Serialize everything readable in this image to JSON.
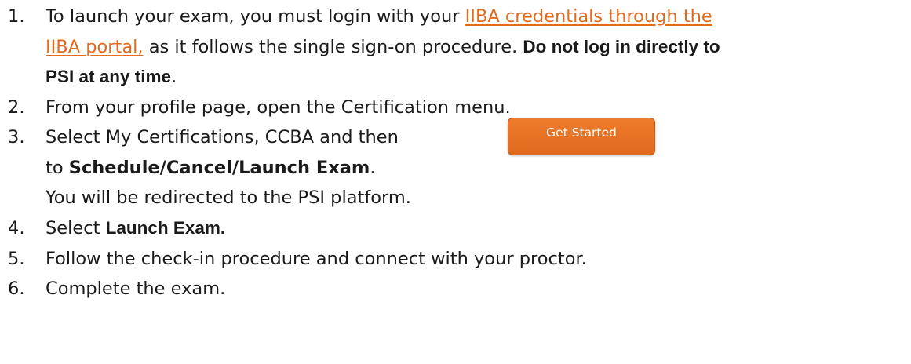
{
  "accent_color": "#e46a1c",
  "steps": [
    {
      "number": "1.",
      "lines": [
        {
          "prefix": "To launch your exam, you must login with your ",
          "link": "IIBA credentials through the"
        },
        {
          "link": "IIBA portal,",
          "text": " as it follows the single sign-on procedure.  ",
          "bold": "Do not log in directly to"
        },
        {
          "bold": "PSI at any time",
          "suffix": "."
        }
      ]
    },
    {
      "number": "2.",
      "text": "From your profile page, open the Certification menu."
    },
    {
      "number": "3.",
      "text": "Select My Certifications, CCBA and then",
      "button_label": "Get Started",
      "line2_prefix": "to ",
      "line2_bold": "Schedule/Cancel/Launch Exam",
      "line2_suffix": ".",
      "line3": "You will be redirected to the PSI platform."
    },
    {
      "number": "4.",
      "prefix": "Select ",
      "bold": "Launch Exam."
    },
    {
      "number": "5.",
      "text": "Follow the check-in procedure and connect with your proctor."
    },
    {
      "number": "6.",
      "text": "Complete the exam."
    }
  ]
}
